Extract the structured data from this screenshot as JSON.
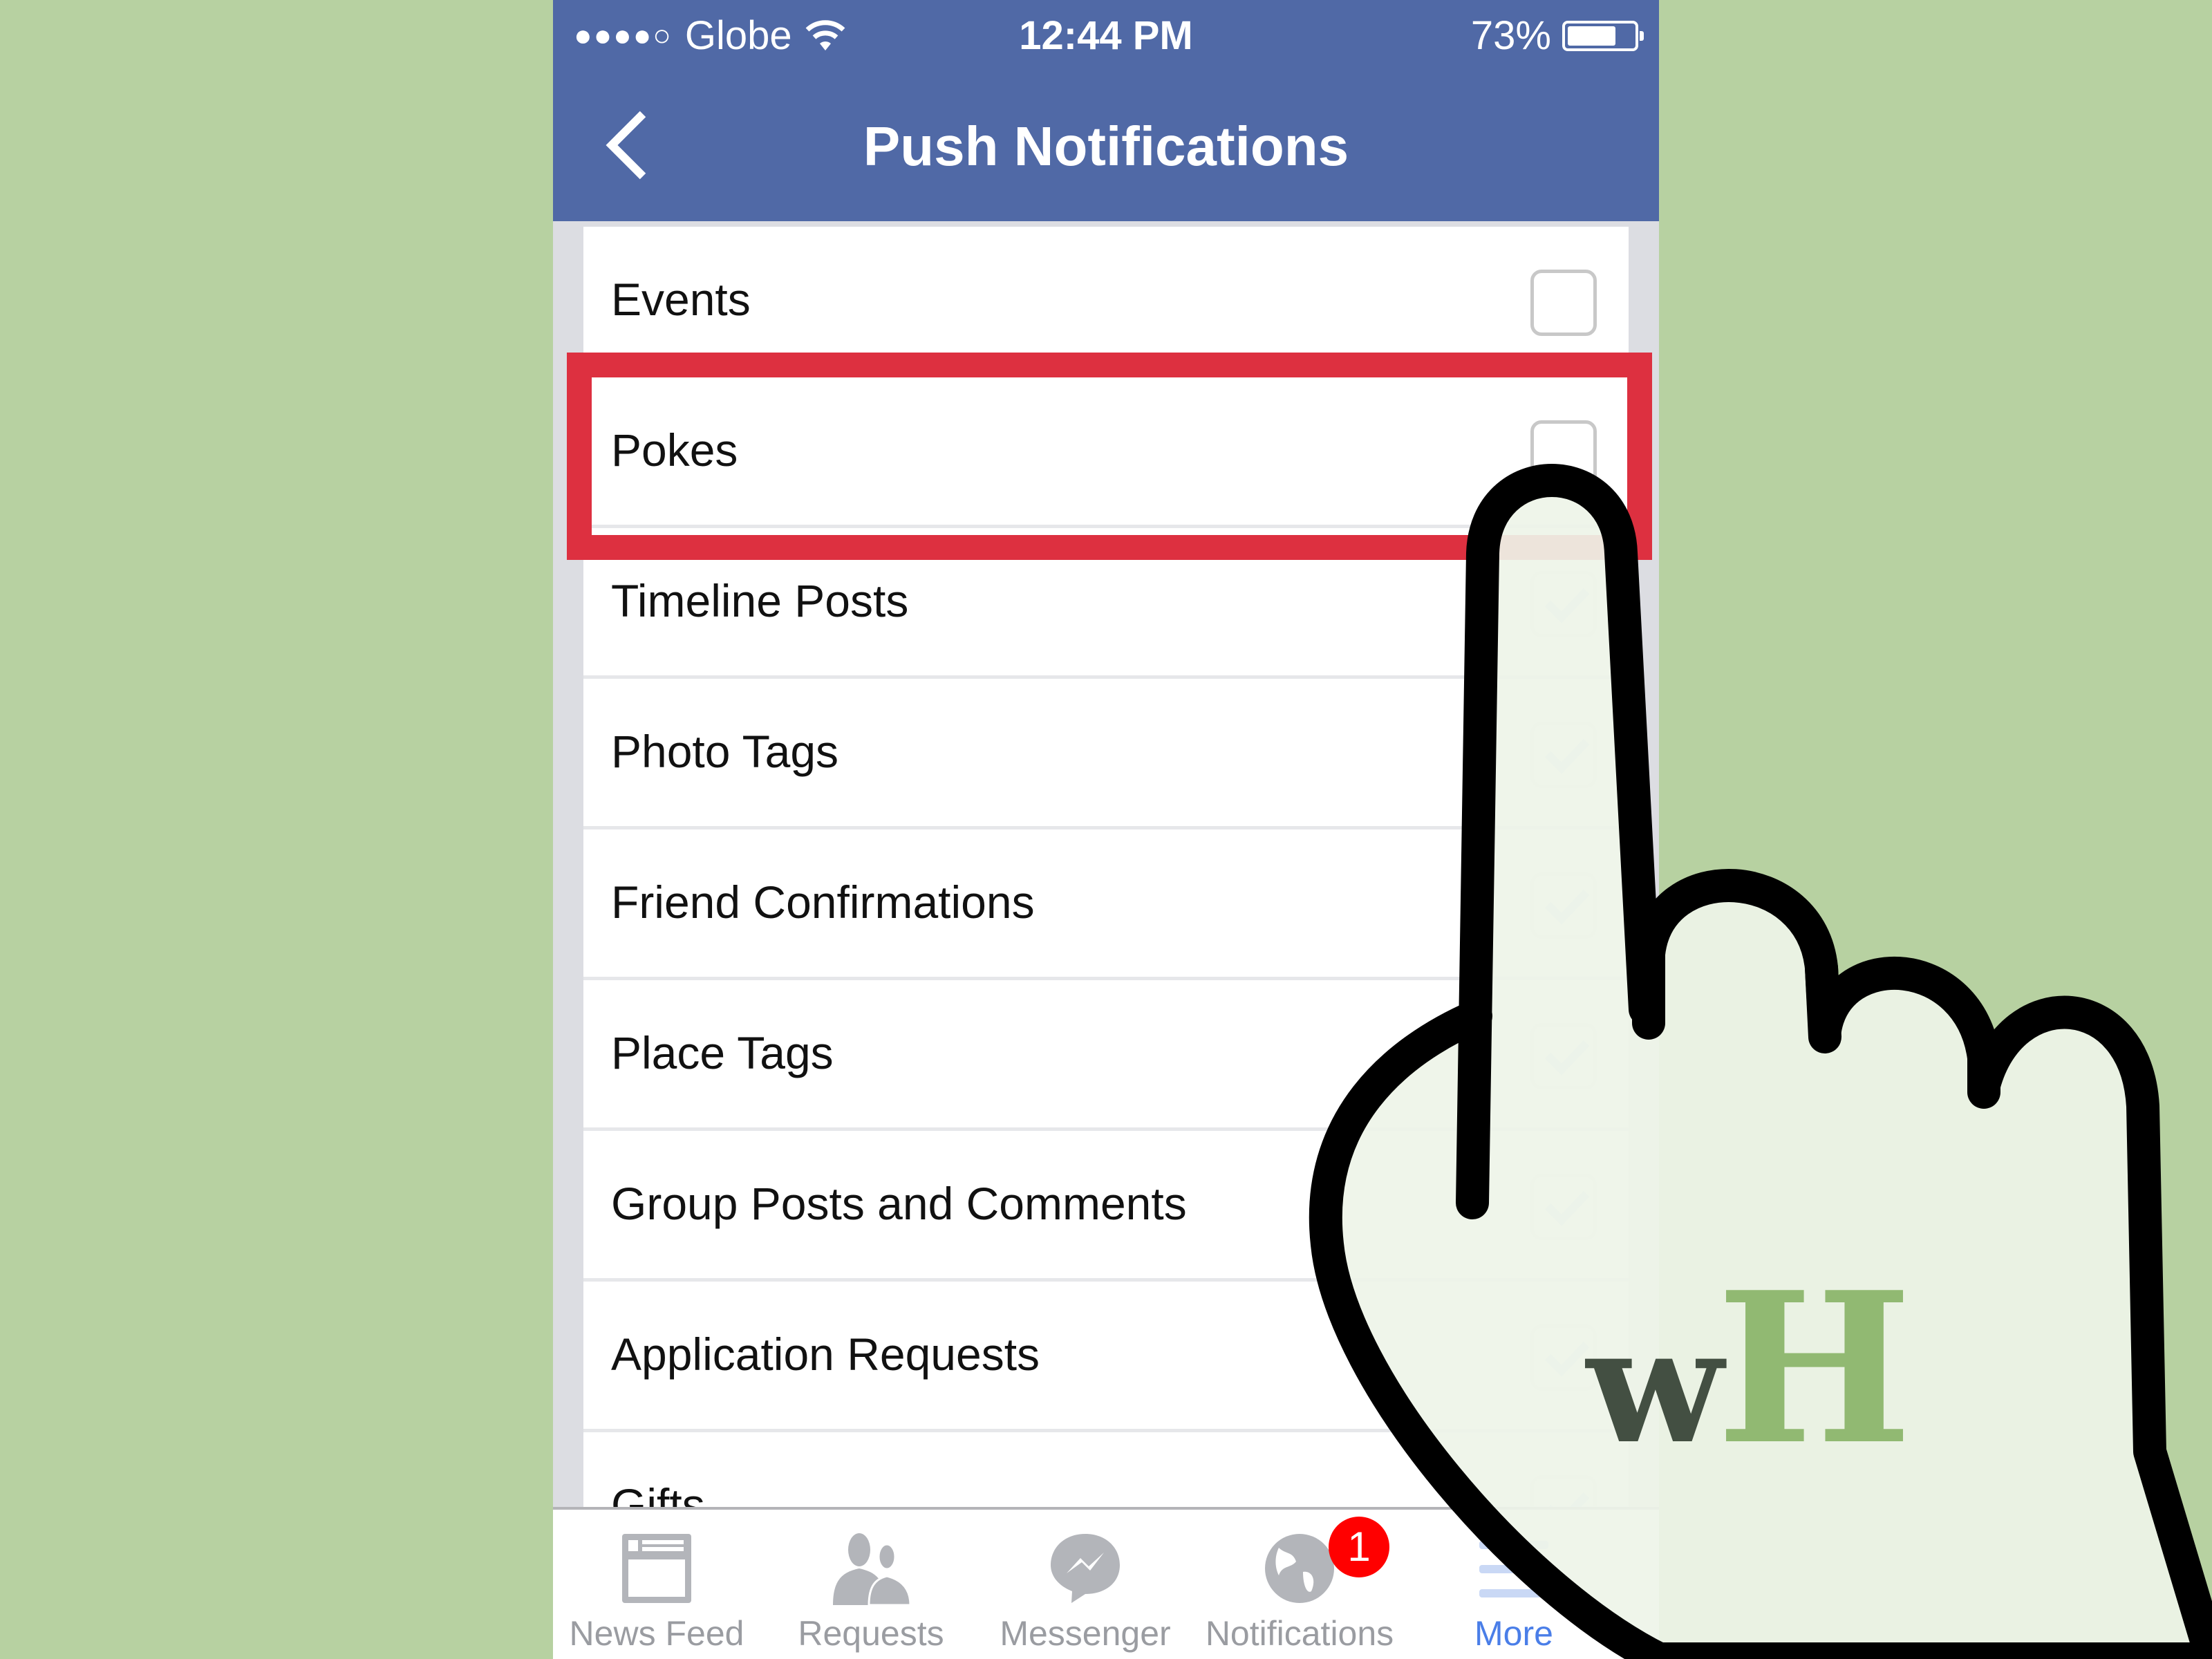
{
  "status_bar": {
    "signal_dots": "●●●●○",
    "carrier": "Globe",
    "wifi_icon": "wifi-icon",
    "time": "12:44 PM",
    "battery_percent": "73%",
    "battery_level": 0.73
  },
  "nav": {
    "back_icon": "chevron-left-icon",
    "title": "Push Notifications"
  },
  "settings": [
    {
      "label": "Events",
      "checked": false
    },
    {
      "label": "Pokes",
      "checked": false,
      "highlighted": true
    },
    {
      "label": "Timeline Posts",
      "checked": true
    },
    {
      "label": "Photo Tags",
      "checked": true
    },
    {
      "label": "Friend Confirmations",
      "checked": true
    },
    {
      "label": "Place Tags",
      "checked": true
    },
    {
      "label": "Group Posts and Comments",
      "checked": true
    },
    {
      "label": "Application Requests",
      "checked": true
    },
    {
      "label": "Gifts",
      "checked": true
    }
  ],
  "tabbar": [
    {
      "label": "News Feed",
      "icon": "news-feed-icon"
    },
    {
      "label": "Requests",
      "icon": "friend-requests-icon"
    },
    {
      "label": "Messenger",
      "icon": "messenger-icon"
    },
    {
      "label": "Notifications",
      "icon": "globe-icon",
      "badge": "1"
    },
    {
      "label": "More",
      "icon": "menu-icon",
      "active": true
    }
  ],
  "colors": {
    "header": "#5069a6",
    "highlight": "#dd3040",
    "badge": "#ff0000",
    "active_tab": "#4a7ee8",
    "background": "#b7d1a1"
  },
  "watermark": {
    "w": "w",
    "h": "H"
  }
}
